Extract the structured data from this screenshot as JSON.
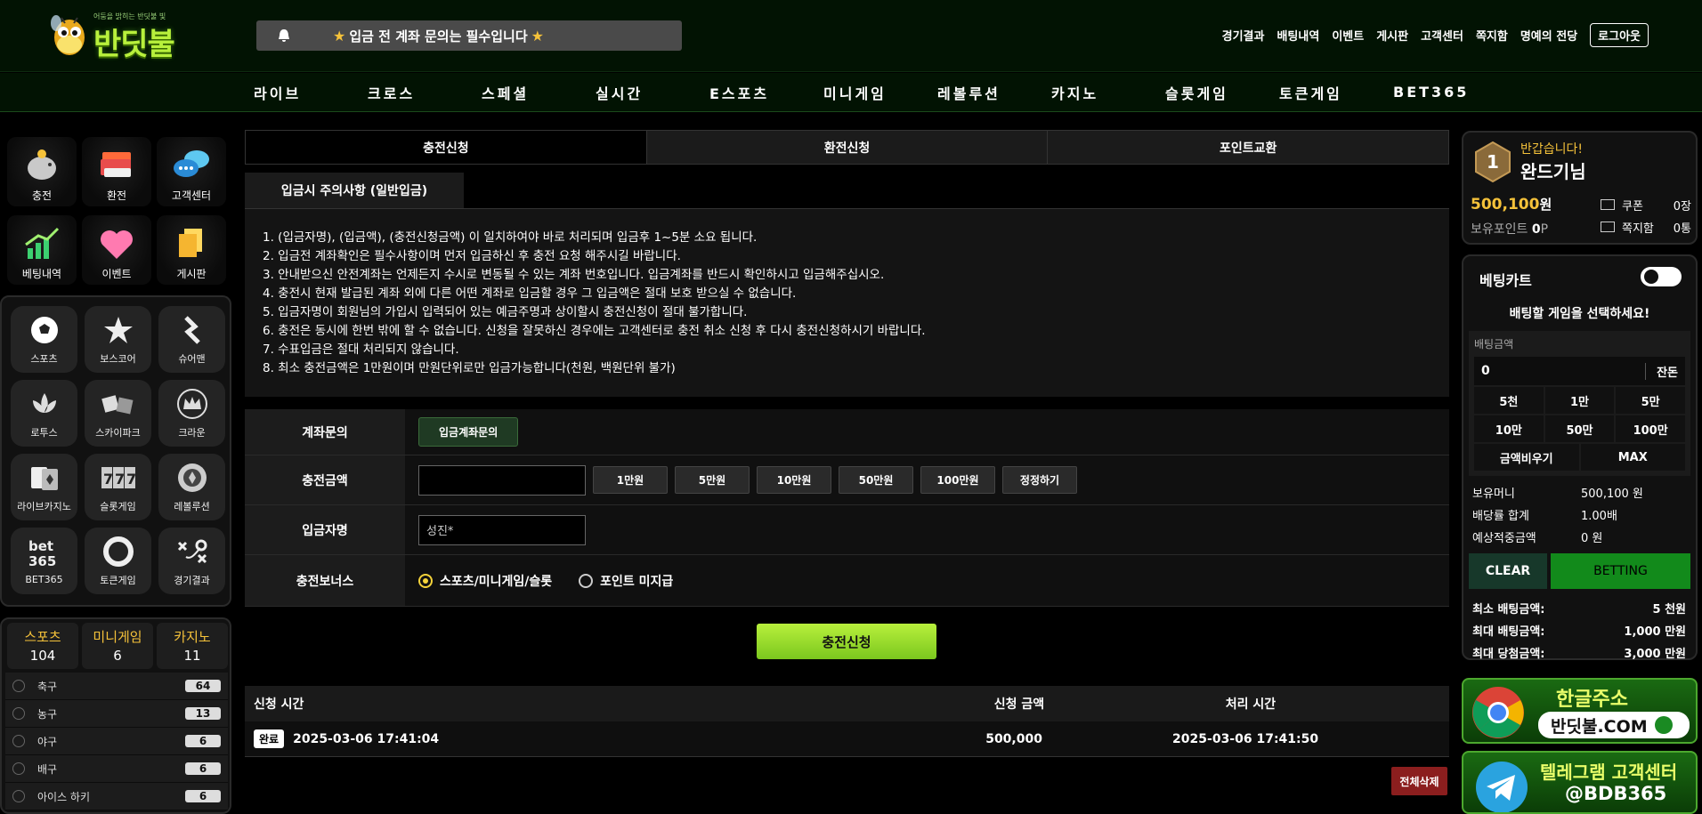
{
  "brand": {
    "logo_text": "반딧불",
    "logo_tagline": "어둠을 밝히는 반딧불 빛"
  },
  "notice": {
    "text": "입금 전 계좌 문의는 필수입니다"
  },
  "topnav": [
    "경기결과",
    "배팅내역",
    "이벤트",
    "게시판",
    "고객센터",
    "쪽지함",
    "명예의 전당"
  ],
  "logout": "로그아웃",
  "mainnav": [
    "라이브",
    "크로스",
    "스페셜",
    "실시간",
    "E스포츠",
    "미니게임",
    "레볼루션",
    "카지노",
    "슬롯게임",
    "토큰게임",
    "BET365"
  ],
  "quick": [
    {
      "label": "충전",
      "icon": "piggy-bank-icon"
    },
    {
      "label": "환전",
      "icon": "cash-icon"
    },
    {
      "label": "고객센터",
      "icon": "chat-bubbles-icon"
    },
    {
      "label": "베팅내역",
      "icon": "bar-chart-icon"
    },
    {
      "label": "이벤트",
      "icon": "heart-icon"
    },
    {
      "label": "게시판",
      "icon": "notes-icon"
    }
  ],
  "games": [
    {
      "label": "스포츠",
      "icon": "soccer-ball-icon"
    },
    {
      "label": "보스코어",
      "icon": "star-icon"
    },
    {
      "label": "슈어맨",
      "icon": "sureman-logo-icon"
    },
    {
      "label": "로투스",
      "icon": "lotus-icon"
    },
    {
      "label": "스카이파크",
      "icon": "dice-icon"
    },
    {
      "label": "크라운",
      "icon": "crown-icon"
    },
    {
      "label": "라이브카지노",
      "icon": "cards-icon"
    },
    {
      "label": "슬롯게임",
      "icon": "slot-777-icon"
    },
    {
      "label": "레볼루션",
      "icon": "poker-chip-icon"
    },
    {
      "label": "BET365",
      "icon": "bet365-logo-icon"
    },
    {
      "label": "토큰게임",
      "icon": "token-ring-icon"
    },
    {
      "label": "경기결과",
      "icon": "tactics-board-icon"
    }
  ],
  "sport_tabs": [
    {
      "label": "스포츠",
      "count": "104"
    },
    {
      "label": "미니게임",
      "count": "6"
    },
    {
      "label": "카지노",
      "count": "11"
    }
  ],
  "sport_list": [
    {
      "name": "축구",
      "count": "64"
    },
    {
      "name": "농구",
      "count": "13"
    },
    {
      "name": "야구",
      "count": "6"
    },
    {
      "name": "배구",
      "count": "6"
    },
    {
      "name": "아이스 하키",
      "count": "6"
    }
  ],
  "tabs": [
    "충전신청",
    "환전신청",
    "포인트교환"
  ],
  "subtitle": "입금시 주의사항 (일반입금)",
  "rules": [
    "1. (입금자명), (입금액), (충전신청금액) 이 일치하여야 바로 처리되며 입금후 1~5분 소요 됩니다.",
    "2. 입금전 계좌확인은 필수사항이며 먼저 입금하신 후 충전 요청 해주시길 바랍니다.",
    "3. 안내받으신 안전계좌는 언제든지 수시로 변동될 수 있는 계좌 번호입니다. 입금계좌를 반드시 확인하시고 입금해주십시오.",
    "4. 충전시 현재 발급된 계좌 외에 다른 어떤 계좌로 입금할 경우 그 입금액은 절대 보호 받으실 수 없습니다.",
    "5. 입금자명이 회원님의 가입시 입력되어 있는 예금주명과 상이할시 충전신청이 절대 불가합니다.",
    "6. 충전은 동시에 한번 밖에 할 수 없습니다. 신청을 잘못하신 경우에는 고객센터로 충전 취소 신청 후 다시 충전신청하시기 바랍니다.",
    "7. 수표입금은 절대 처리되지 않습니다.",
    "8. 최소 충전금액은 1만원이며 만원단위로만 입금가능합니다(천원, 백원단위 불가)"
  ],
  "form": {
    "account_label": "계좌문의",
    "account_button": "입금계좌문의",
    "amount_label": "충전금액",
    "amount_value": "",
    "amount_buttons": [
      "1만원",
      "5만원",
      "10만원",
      "50만원",
      "100만원",
      "정정하기"
    ],
    "depositor_label": "입금자명",
    "depositor_value": "성진*",
    "bonus_label": "충전보너스",
    "bonus_options": [
      "스포츠/미니게임/슬롯",
      "포인트 미지급"
    ]
  },
  "submit": "충전신청",
  "history": {
    "headers": [
      "신청 시간",
      "신청 금액",
      "처리 시간"
    ],
    "rows": [
      {
        "status": "완료",
        "requested": "2025-03-06 17:41:04",
        "amount": "500,000",
        "processed": "2025-03-06 17:41:50"
      }
    ],
    "delete_all": "전체삭제"
  },
  "user": {
    "level": "1",
    "greeting": "반갑습니다!",
    "name": "완드기님",
    "money": "500,100",
    "money_unit": "원",
    "points_label": "보유포인트",
    "points": "0",
    "points_unit": "P",
    "coupon_label": "쿠폰",
    "coupon_value": "0장",
    "msg_label": "쪽지함",
    "msg_value": "0통"
  },
  "cart": {
    "title": "베팅카트",
    "message": "배팅할 게임을 선택하세요!",
    "amount_label": "배팅금액",
    "amount_value": "0",
    "balance_button": "잔돈",
    "quick_amounts": [
      "5천",
      "1만",
      "5만",
      "10만",
      "50만",
      "100만"
    ],
    "clear_amount": "금액비우기",
    "max": "MAX",
    "info": [
      {
        "label": "보유머니",
        "value": "500,100 원"
      },
      {
        "label": "배당률 합계",
        "value": "1.00배"
      },
      {
        "label": "예상적중금액",
        "value": "0 원"
      }
    ],
    "clear": "CLEAR",
    "betting": "BETTING",
    "limits": [
      {
        "label": "최소 배팅금액:",
        "value": "5 천원"
      },
      {
        "label": "최대 배팅금액:",
        "value": "1,000 만원"
      },
      {
        "label": "최대 당첨금액:",
        "value": "3,000 만원"
      }
    ]
  },
  "banners": {
    "domain_title": "한글주소",
    "domain": "반딧불.COM",
    "telegram_title": "텔레그램 고객센터",
    "telegram_id": "@BDB365"
  },
  "colors": {
    "accent_green": "#b8f03c",
    "gold": "#f5c23a",
    "danger": "#8b1e1e",
    "betting_green": "#128a1b"
  }
}
